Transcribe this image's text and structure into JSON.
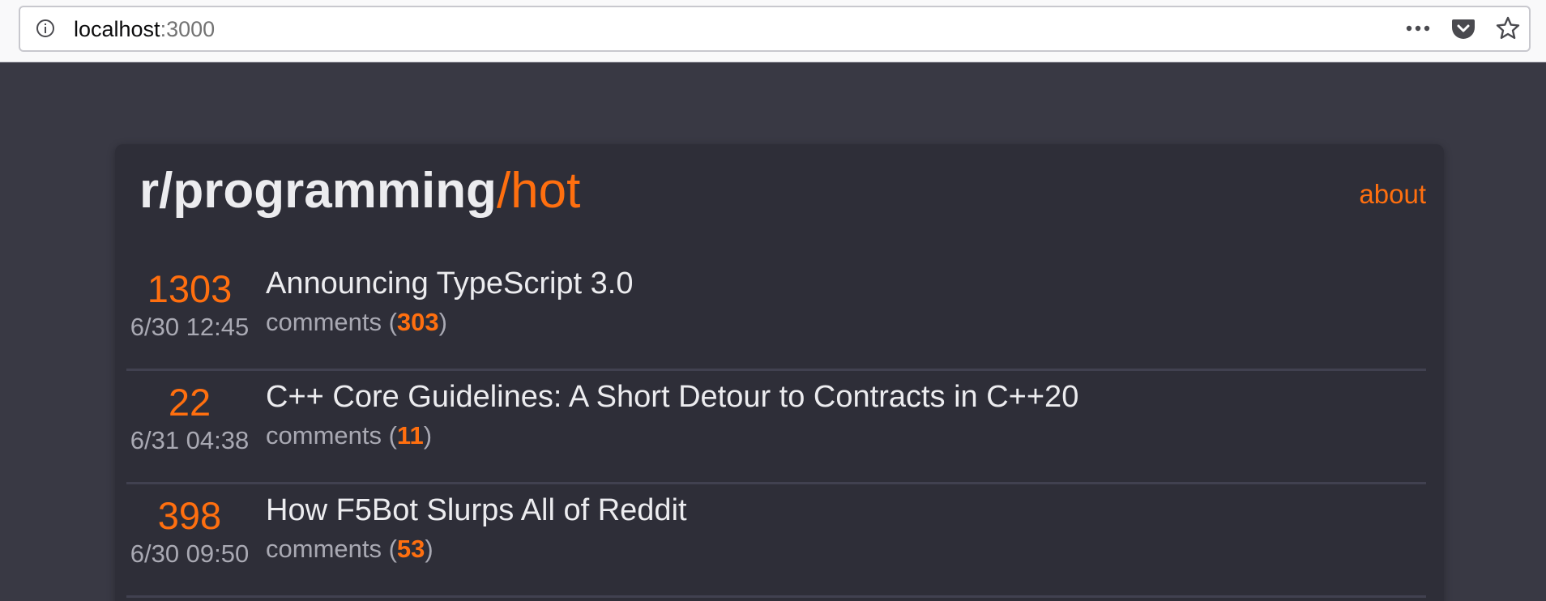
{
  "browser": {
    "url_host": "localhost",
    "url_port": ":3000"
  },
  "header": {
    "title_main": "r/programming",
    "title_accent": "/hot",
    "about_label": "about"
  },
  "posts": [
    {
      "score": "1303",
      "time": "6/30 12:45",
      "title": "Announcing TypeScript 3.0",
      "comments_label": "comments (",
      "comments_count": "303",
      "comments_close": ")"
    },
    {
      "score": "22",
      "time": "6/31 04:38",
      "title": "C++ Core Guidelines: A Short Detour to Contracts in C++20",
      "comments_label": "comments (",
      "comments_count": "11",
      "comments_close": ")"
    },
    {
      "score": "398",
      "time": "6/30 09:50",
      "title": "How F5Bot Slurps All of Reddit",
      "comments_label": "comments (",
      "comments_count": "53",
      "comments_close": ")"
    }
  ],
  "icons": {
    "info": "info-icon",
    "more": "more-icon",
    "pocket": "pocket-icon",
    "bookmark": "star-icon"
  },
  "colors": {
    "accent": "#ff6f0f",
    "background": "#393944",
    "card": "#2e2e38"
  }
}
